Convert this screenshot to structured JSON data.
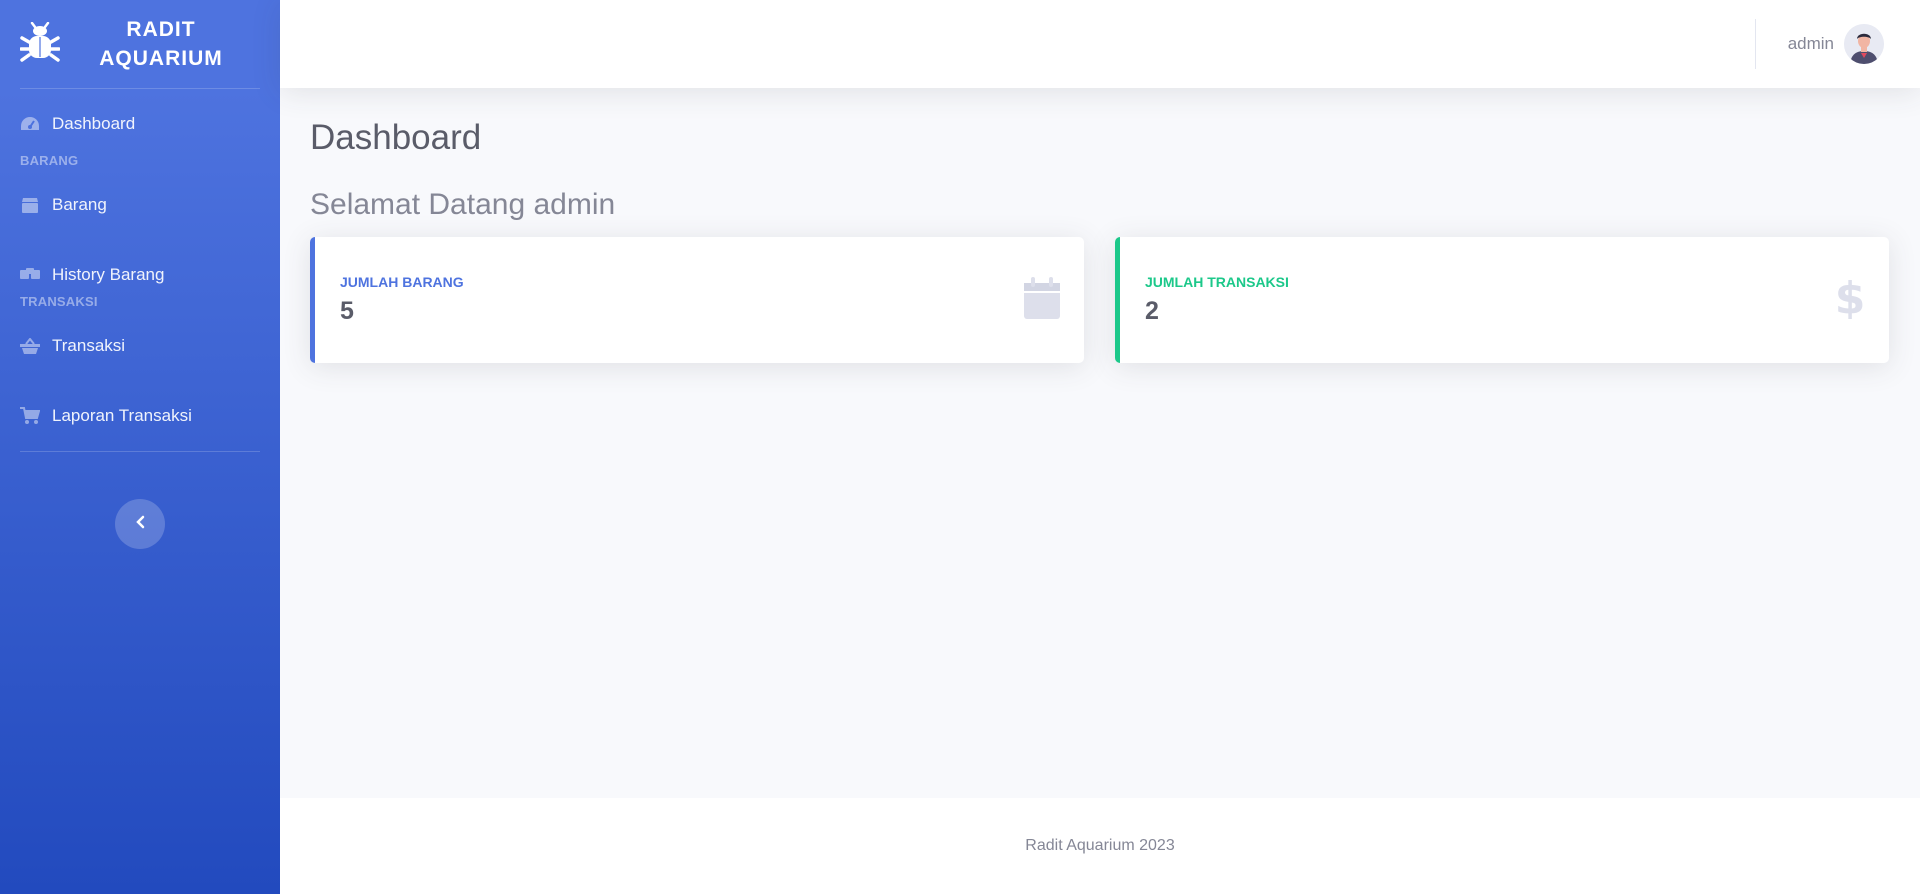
{
  "brand": {
    "name": "RADIT\nAQUARIUM",
    "icon": "bug-icon"
  },
  "sidebar": {
    "items": [
      {
        "label": "Dashboard",
        "icon": "tachometer-icon"
      },
      {
        "heading": "BARANG"
      },
      {
        "label": "Barang",
        "icon": "box-icon"
      },
      {
        "label": "History Barang",
        "icon": "boxes-icon"
      },
      {
        "heading": "TRANSAKSI"
      },
      {
        "label": "Transaksi",
        "icon": "basket-icon"
      },
      {
        "label": "Laporan Transaksi",
        "icon": "cart-icon"
      }
    ],
    "toggle_icon": "chevron-left-icon"
  },
  "topbar": {
    "user_name": "admin",
    "avatar": "user-avatar"
  },
  "main": {
    "title": "Dashboard",
    "welcome": "Selamat Datang admin",
    "cards": [
      {
        "label": "JUMLAH BARANG",
        "value": "5",
        "accent": "#4e73df",
        "icon": "calendar-icon"
      },
      {
        "label": "JUMLAH TRANSAKSI",
        "value": "2",
        "accent": "#1cc88a",
        "icon": "dollar-icon"
      }
    ]
  },
  "footer": {
    "text": "Radit Aquarium 2023"
  },
  "colors": {
    "primary": "#4e73df",
    "success": "#1cc88a",
    "sidebar_end": "#224abe"
  }
}
